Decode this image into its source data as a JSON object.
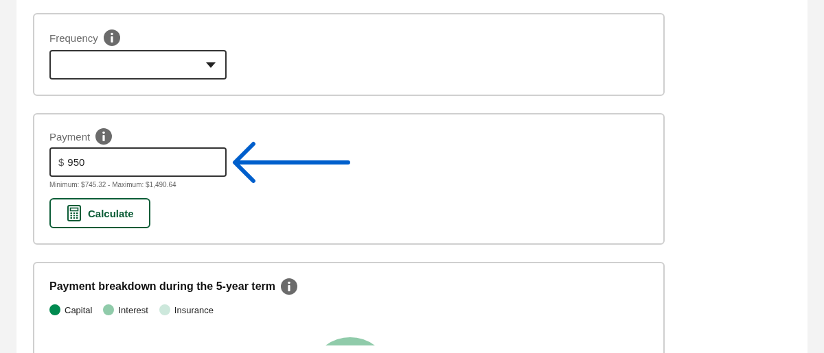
{
  "frequency": {
    "label": "Frequency"
  },
  "payment": {
    "label": "Payment",
    "prefix": "$",
    "value": "950",
    "hint": "Minimum: $745.32 - Maximum: $1,490.64",
    "button": "Calculate"
  },
  "breakdown": {
    "title": "Payment breakdown during the 5-year term",
    "legend": [
      {
        "label": "Capital",
        "color": "#008a50"
      },
      {
        "label": "Interest",
        "color": "#90cbaa"
      },
      {
        "label": "Insurance",
        "color": "#cde8dc"
      }
    ]
  }
}
